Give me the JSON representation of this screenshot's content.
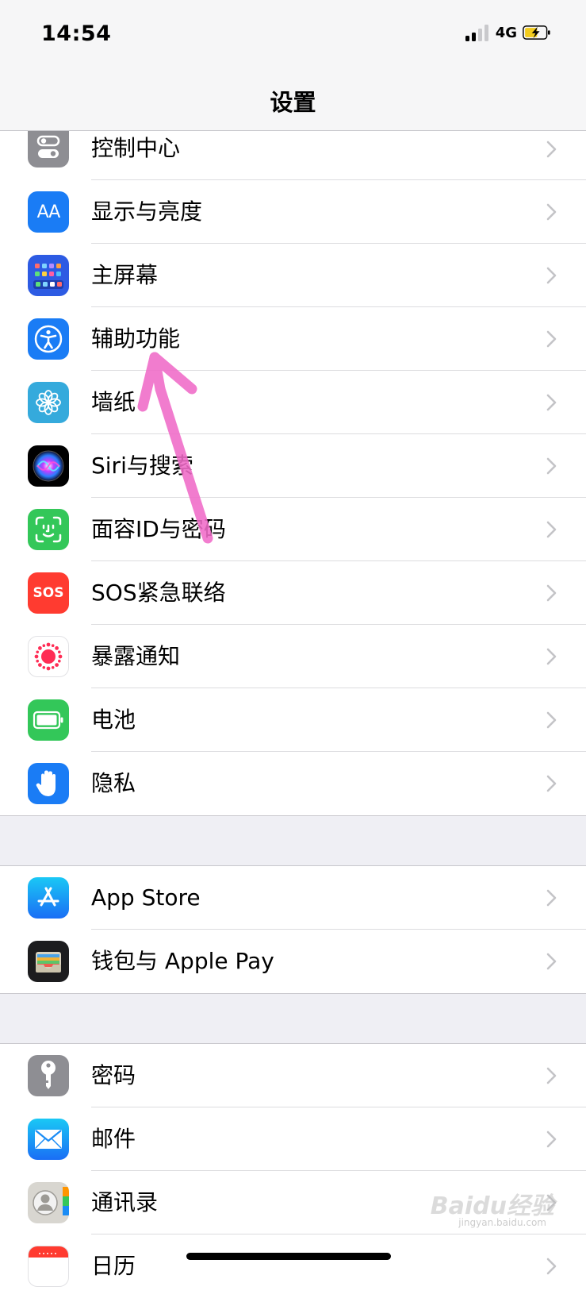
{
  "status": {
    "time": "14:54",
    "network": "4G"
  },
  "nav": {
    "title": "设置"
  },
  "groups": [
    {
      "items": [
        {
          "label": "控制中心",
          "icon": "control-center-icon",
          "color": "#8e8e93"
        },
        {
          "label": "显示与亮度",
          "icon": "display-brightness-icon",
          "color": "#1a7cf5",
          "glyph": "AA"
        },
        {
          "label": "主屏幕",
          "icon": "home-screen-icon",
          "color": "#2d5be3"
        },
        {
          "label": "辅助功能",
          "icon": "accessibility-icon",
          "color": "#1a7cf5"
        },
        {
          "label": "墙纸",
          "icon": "wallpaper-icon",
          "color": "#35aadc"
        },
        {
          "label": "Siri与搜索",
          "icon": "siri-icon",
          "color": "#1c1c3a"
        },
        {
          "label": "面容ID与密码",
          "icon": "face-id-icon",
          "color": "#33c759"
        },
        {
          "label": "SOS紧急联络",
          "icon": "sos-icon",
          "color": "#ff3b30",
          "glyph": "SOS"
        },
        {
          "label": "暴露通知",
          "icon": "exposure-notification-icon",
          "color": "#ffffff"
        },
        {
          "label": "电池",
          "icon": "battery-icon",
          "color": "#33c759"
        },
        {
          "label": "隐私",
          "icon": "privacy-hand-icon",
          "color": "#1a7cf5"
        }
      ]
    },
    {
      "items": [
        {
          "label": "App Store",
          "icon": "app-store-icon",
          "color": "#1a8cf5"
        },
        {
          "label": "钱包与 Apple Pay",
          "icon": "wallet-icon",
          "color": "#1c1c1e"
        }
      ]
    },
    {
      "items": [
        {
          "label": "密码",
          "icon": "passwords-key-icon",
          "color": "#8e8e93"
        },
        {
          "label": "邮件",
          "icon": "mail-icon",
          "color": "#1a8cf5"
        },
        {
          "label": "通讯录",
          "icon": "contacts-icon",
          "color": "#d8d6d0"
        },
        {
          "label": "日历",
          "icon": "calendar-icon",
          "color": "#ffffff"
        }
      ]
    }
  ],
  "watermark": {
    "brand": "Baidu经验",
    "url": "jingyan.baidu.com"
  },
  "colors": {
    "annotation_arrow": "#f06bc8",
    "separator": "#dcdcdf",
    "group_gap": "#efeff4",
    "chevron": "#c4c4c7"
  }
}
